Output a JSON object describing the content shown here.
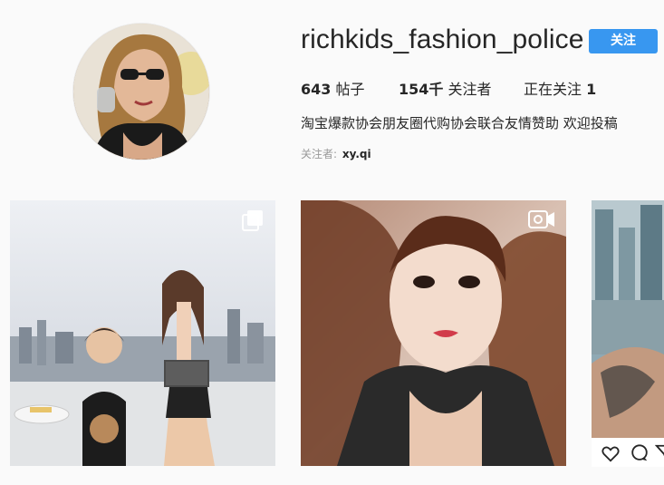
{
  "profile": {
    "username": "richkids_fashion_police",
    "follow_label": "关注",
    "stats": {
      "posts_count": "643",
      "posts_label": "帖子",
      "followers_count": "154千",
      "followers_label": "关注者",
      "following_label": "正在关注",
      "following_count": "1"
    },
    "bio": "淘宝爆款协会朋友圈代购协会联合友情赞助 欢迎投稿",
    "followed_by_label": "关注者:",
    "followed_by_user": "xy.qi"
  },
  "posts": [
    {
      "kind": "multi-photo",
      "badge_icon": "carousel-icon"
    },
    {
      "kind": "video",
      "badge_icon": "video-camera-icon"
    },
    {
      "kind": "photo"
    }
  ],
  "post_actions": {
    "icons": [
      "heart-icon",
      "comment-icon",
      "share-icon"
    ]
  },
  "colors": {
    "background": "#fafafa",
    "accent": "#3897f0",
    "text": "#262626",
    "muted": "#999999"
  }
}
